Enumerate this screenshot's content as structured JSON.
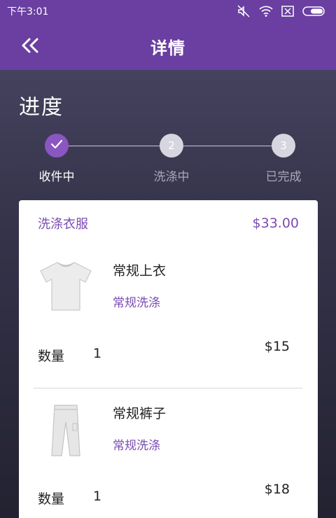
{
  "status_bar": {
    "time": "下午3:01",
    "icons": [
      "mute-icon",
      "wifi-icon",
      "sim-icon",
      "battery-icon"
    ]
  },
  "header": {
    "back_icon": "double-chevron-left-icon",
    "title": "详情"
  },
  "progress": {
    "title": "进度",
    "steps": [
      {
        "label": "收件中",
        "marker": "✓",
        "state": "done"
      },
      {
        "label": "洗涤中",
        "marker": "2",
        "state": "pending"
      },
      {
        "label": "已完成",
        "marker": "3",
        "state": "pending"
      }
    ]
  },
  "order": {
    "category": "洗涤衣服",
    "total": "$33.00",
    "items": [
      {
        "name": "常规上衣",
        "service": "常规洗涤",
        "qty_label": "数量",
        "qty": "1",
        "price": "$15",
        "image": "tshirt-image"
      },
      {
        "name": "常规裤子",
        "service": "常规洗涤",
        "qty_label": "数量",
        "qty": "1",
        "price": "$18",
        "image": "pants-image"
      }
    ]
  },
  "colors": {
    "accent": "#6a3fa1",
    "step_active": "#8a56c2",
    "step_pending": "#d7d5df",
    "text_purple": "#7a4bb0"
  }
}
